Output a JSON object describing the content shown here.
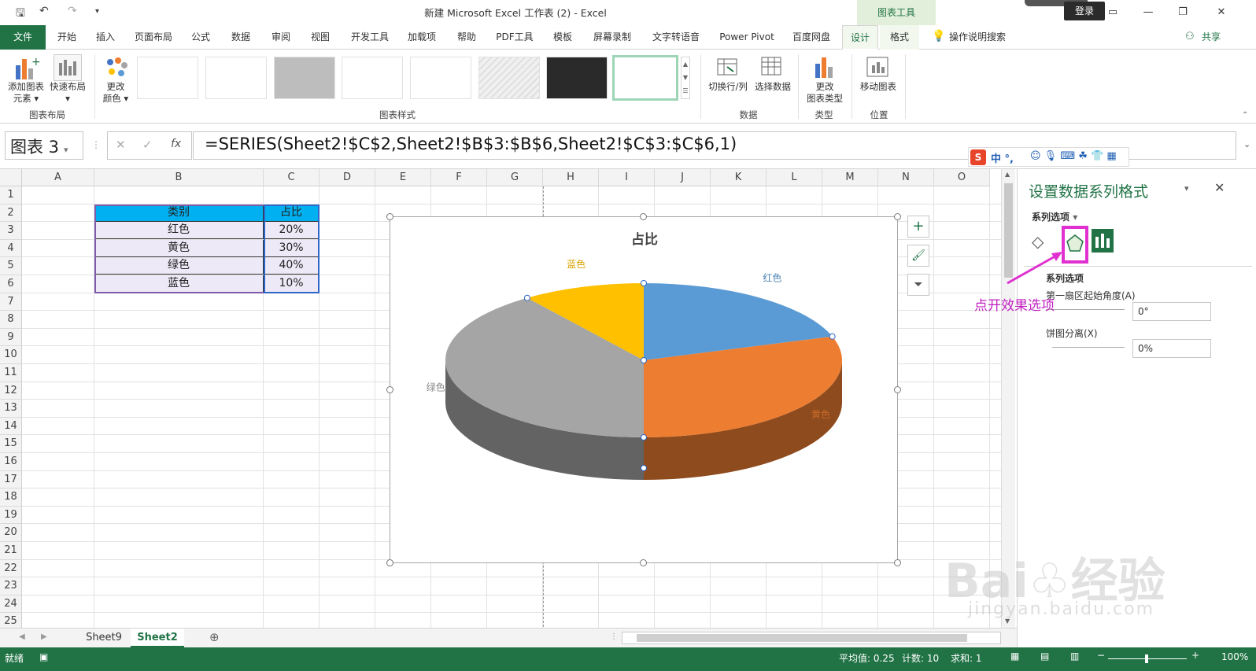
{
  "window": {
    "title": "新建 Microsoft Excel 工作表 (2)  -  Excel",
    "context_tab_group": "图表工具",
    "login": "登录"
  },
  "tabs": {
    "file": "文件",
    "items": [
      "开始",
      "插入",
      "页面布局",
      "公式",
      "数据",
      "审阅",
      "视图",
      "开发工具",
      "加载项",
      "帮助",
      "PDF工具",
      "模板",
      "屏幕录制",
      "文字转语音",
      "Power Pivot",
      "百度网盘"
    ],
    "design": "设计",
    "format": "格式",
    "tell_me": "操作说明搜索",
    "share": "共享"
  },
  "ribbon": {
    "add_element_1": "添加图表",
    "add_element_2": "元素",
    "quick_layout": "快速布局",
    "change_color_1": "更改",
    "change_color_2": "颜色",
    "switch_row_col": "切换行/列",
    "select_data": "选择数据",
    "change_type_1": "更改",
    "change_type_2": "图表类型",
    "move_chart": "移动图表",
    "groups": {
      "layout": "图表布局",
      "styles": "图表样式",
      "data": "数据",
      "type": "类型",
      "location": "位置"
    }
  },
  "formula_bar": {
    "name_box": "图表 3",
    "formula": "=SERIES(Sheet2!$C$2,Sheet2!$B$3:$B$6,Sheet2!$C$3:$C$6,1)"
  },
  "grid": {
    "columns": [
      "A",
      "B",
      "C",
      "D",
      "E",
      "F",
      "G",
      "H",
      "I",
      "J",
      "K",
      "L",
      "M",
      "N",
      "O"
    ],
    "rows": [
      "1",
      "2",
      "3",
      "4",
      "5",
      "6",
      "7",
      "8",
      "9",
      "10",
      "11",
      "12",
      "13",
      "14",
      "15",
      "16",
      "17",
      "18",
      "19",
      "20",
      "21",
      "22",
      "23",
      "24",
      "25"
    ],
    "table": {
      "header": [
        "类别",
        "占比"
      ],
      "rows": [
        [
          "红色",
          "20%"
        ],
        [
          "黄色",
          "30%"
        ],
        [
          "绿色",
          "40%"
        ],
        [
          "蓝色",
          "10%"
        ]
      ]
    }
  },
  "chart_data": {
    "type": "pie",
    "title": "占比",
    "categories": [
      "红色",
      "黄色",
      "绿色",
      "蓝色"
    ],
    "values": [
      20,
      30,
      40,
      10
    ],
    "colors": [
      "#5b9bd5",
      "#ed7d31",
      "#a5a5a5",
      "#ffc000"
    ],
    "style": "3D pie"
  },
  "pane": {
    "title": "设置数据系列格式",
    "dropdown": "系列选项",
    "section": "系列选项",
    "first_slice_angle_label": "第一扇区起始角度(A)",
    "first_slice_angle_value": "0°",
    "explosion_label": "饼图分离(X)",
    "explosion_value": "0%",
    "annotation": "点开效果选项"
  },
  "sheets": [
    "Sheet9",
    "Sheet2"
  ],
  "status": {
    "ready": "就绪",
    "average": "平均值: 0.25",
    "count": "计数: 10",
    "sum": "求和: 1",
    "zoom": "100%"
  },
  "colors": {
    "excel_green": "#217346",
    "annotation_magenta": "#e030d0",
    "table_header": "#00b0f0",
    "table_body": "#ede9f7"
  }
}
